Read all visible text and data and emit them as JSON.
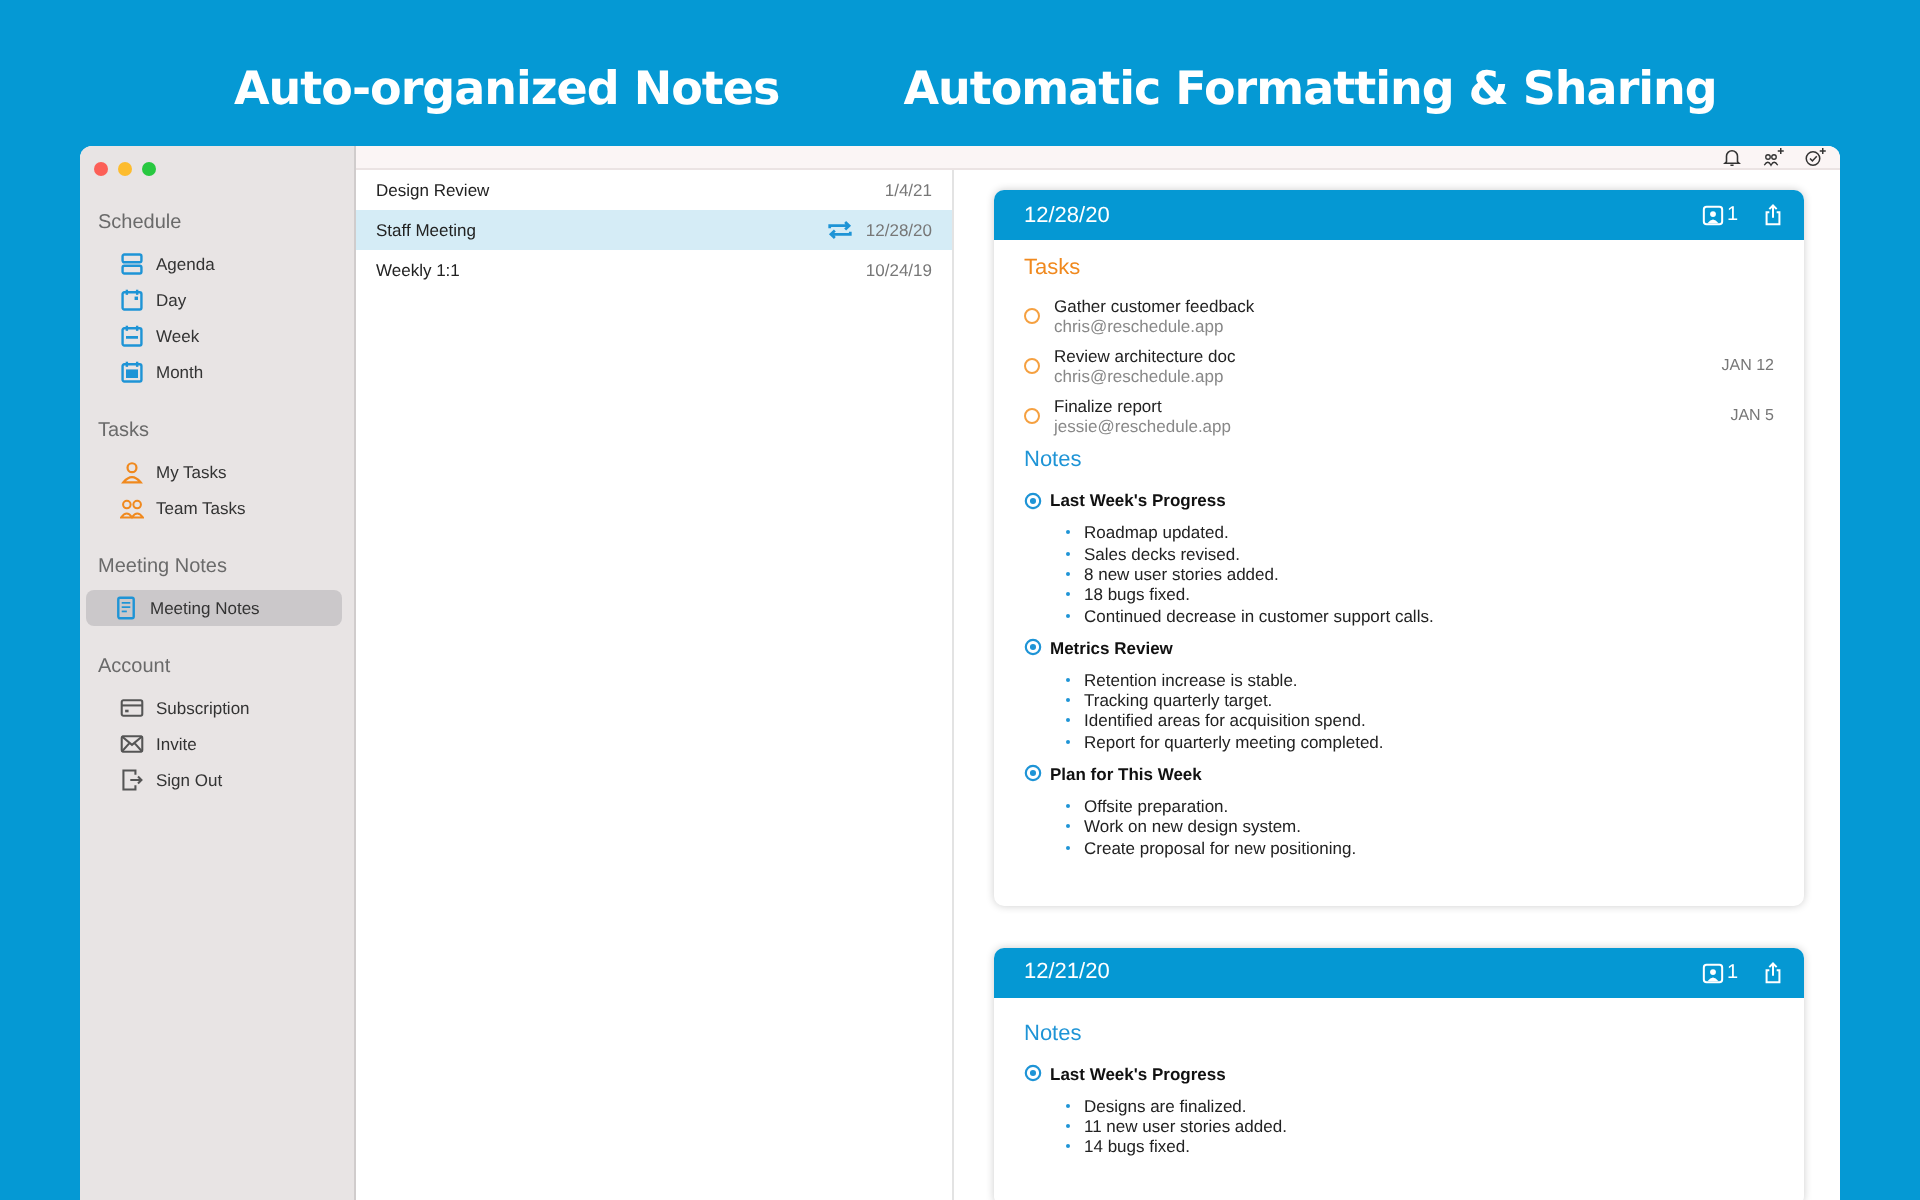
{
  "headlines": [
    "Auto-organized Notes",
    "Automatic Formatting & Sharing"
  ],
  "sidebar": {
    "sections": [
      {
        "title": "Schedule",
        "items": [
          {
            "label": "Agenda",
            "selected": false
          },
          {
            "label": "Day",
            "selected": false
          },
          {
            "label": "Week",
            "selected": false
          },
          {
            "label": "Month",
            "selected": false
          }
        ]
      },
      {
        "title": "Tasks",
        "items": [
          {
            "label": "My Tasks",
            "selected": false
          },
          {
            "label": "Team Tasks",
            "selected": false
          }
        ]
      },
      {
        "title": "Meeting Notes",
        "items": [
          {
            "label": "Meeting Notes",
            "selected": true
          }
        ]
      },
      {
        "title": "Account",
        "items": [
          {
            "label": "Subscription",
            "selected": false
          },
          {
            "label": "Invite",
            "selected": false
          },
          {
            "label": "Sign Out",
            "selected": false
          }
        ]
      }
    ]
  },
  "notes_list": [
    {
      "title": "Design Review",
      "date": "1/4/21",
      "selected": false,
      "recurring": false
    },
    {
      "title": "Staff Meeting",
      "date": "12/28/20",
      "selected": true,
      "recurring": true
    },
    {
      "title": "Weekly 1:1",
      "date": "10/24/19",
      "selected": false,
      "recurring": false
    }
  ],
  "cards": [
    {
      "date": "12/28/20",
      "attendees": "1",
      "tasks_title": "Tasks",
      "tasks": [
        {
          "title": "Gather customer feedback",
          "assignee": "chris@reschedule.app",
          "checked": false
        },
        {
          "title": "Review architecture doc",
          "assignee": "chris@reschedule.app",
          "due": "JAN 12",
          "checked": false
        },
        {
          "title": "Finalize report",
          "assignee": "jessie@reschedule.app",
          "due": "JAN 5",
          "checked": false
        }
      ],
      "notes_title": "Notes",
      "sections": [
        {
          "heading": "Last Week's Progress",
          "bullets": [
            "Roadmap updated.",
            "Sales decks revised.",
            "8 new user stories added.",
            "18 bugs fixed.",
            "Continued decrease in customer support calls."
          ]
        },
        {
          "heading": "Metrics Review",
          "bullets": [
            "Retention increase is stable.",
            "Tracking quarterly target.",
            "Identified areas for acquisition spend.",
            "Report for quarterly meeting completed."
          ]
        },
        {
          "heading": "Plan for This Week",
          "bullets": [
            "Offsite preparation.",
            "Work on new design system.",
            "Create proposal for new positioning."
          ]
        }
      ]
    },
    {
      "date": "12/21/20",
      "attendees": "1",
      "notes_title": "Notes",
      "sections": [
        {
          "heading": "Last Week's Progress",
          "bullets": [
            "Designs are finalized.",
            "11 new user stories added.",
            "14 bugs fixed."
          ]
        }
      ]
    }
  ]
}
